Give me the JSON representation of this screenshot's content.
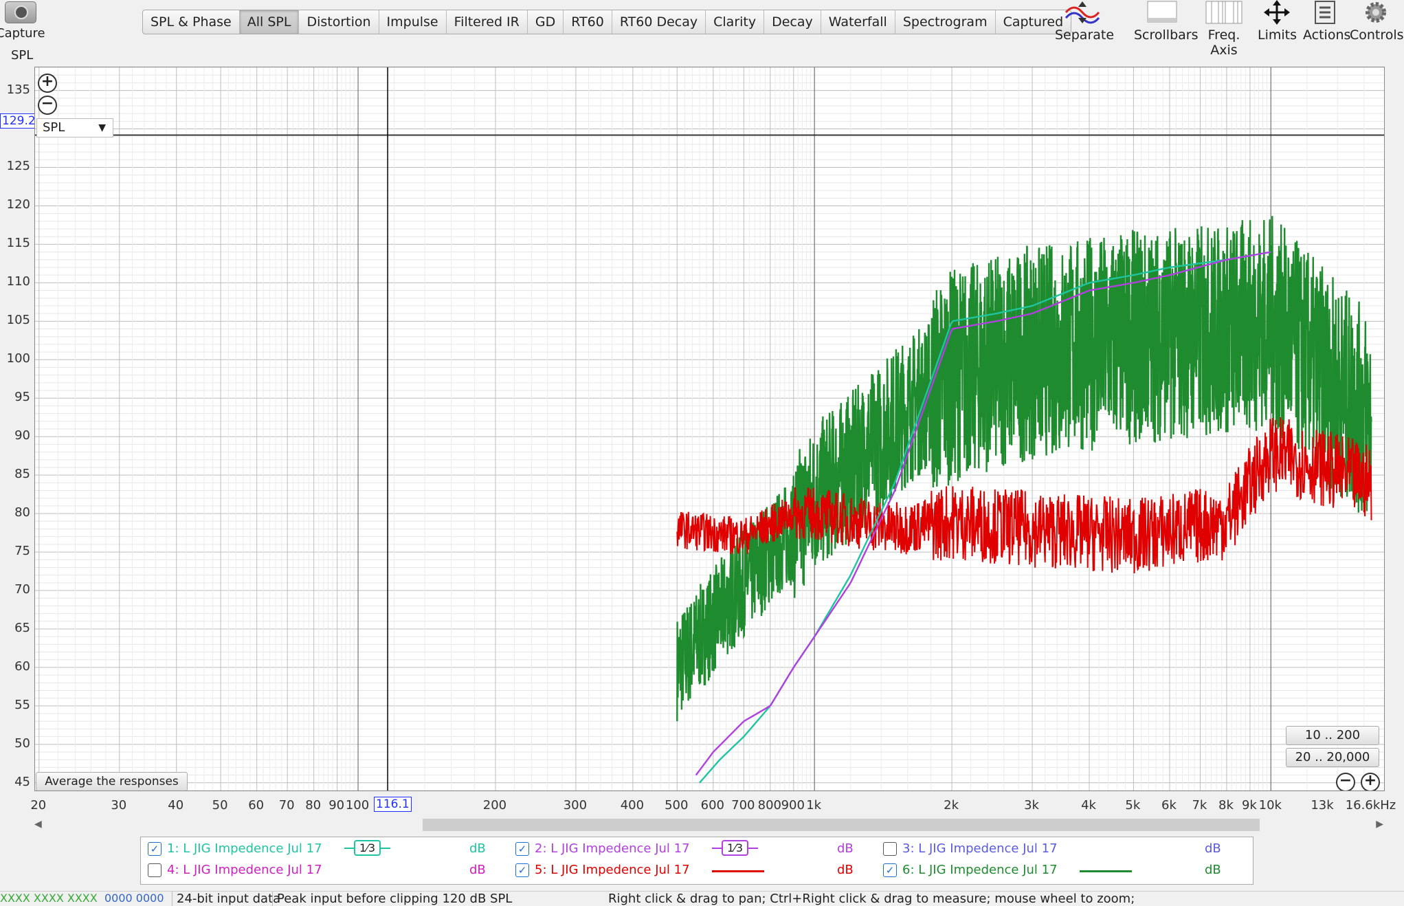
{
  "toolbar": {
    "capture_label": "Capture",
    "tabs": [
      {
        "label": "SPL & Phase"
      },
      {
        "label": "All SPL",
        "active": true
      },
      {
        "label": "Distortion"
      },
      {
        "label": "Impulse"
      },
      {
        "label": "Filtered IR"
      },
      {
        "label": "GD"
      },
      {
        "label": "RT60"
      },
      {
        "label": "RT60 Decay"
      },
      {
        "label": "Clarity"
      },
      {
        "label": "Decay"
      },
      {
        "label": "Waterfall"
      },
      {
        "label": "Spectrogram"
      },
      {
        "label": "Captured"
      }
    ],
    "tools": {
      "separate": "Separate",
      "scrollbars": "Scrollbars",
      "freq_axis": "Freq. Axis",
      "limits": "Limits",
      "actions": "Actions",
      "controls": "Controls"
    }
  },
  "plot": {
    "y_axis_title": "SPL",
    "y_cursor_value": "129.2",
    "x_cursor_value": "116.1",
    "trace_selector": "SPL",
    "average_button": "Average the responses",
    "range_button_1": "10 .. 200",
    "range_button_2": "20 .. 20,000"
  },
  "chart_data": {
    "type": "line",
    "xlabel": "",
    "ylabel": "SPL",
    "x_scale": "log",
    "ylim": [
      44,
      138
    ],
    "xlim": [
      19.6,
      17700
    ],
    "grid": true,
    "y_ticks": [
      "135",
      "125",
      "120",
      "115",
      "110",
      "105",
      "100",
      "95",
      "90",
      "85",
      "80",
      "75",
      "70",
      "65",
      "60",
      "55",
      "50",
      "45"
    ],
    "x_ticks": [
      "20",
      "30",
      "40",
      "50",
      "60",
      "70",
      "80",
      "90",
      "100",
      "200",
      "300",
      "400",
      "500",
      "600",
      "700",
      "800",
      "900",
      "1k",
      "2k",
      "3k",
      "4k",
      "5k",
      "6k",
      "7k",
      "8k",
      "9k",
      "10k",
      "13k",
      "16.6kHz"
    ],
    "x_tick_values": [
      20,
      30,
      40,
      50,
      60,
      70,
      80,
      90,
      100,
      200,
      300,
      400,
      500,
      600,
      700,
      800,
      900,
      1000,
      2000,
      3000,
      4000,
      5000,
      6000,
      7000,
      8000,
      9000,
      10000,
      13000,
      16600
    ],
    "cursor": {
      "x": 116.1,
      "y": 129.2
    },
    "series": [
      {
        "name": "1: L JIG Impedence Jul 17",
        "color": "#1fc4a0",
        "x": [
          560,
          620,
          700,
          800,
          900,
          1000,
          1200,
          1500,
          2000,
          2500,
          3000,
          4000,
          5000,
          6000,
          8000,
          10000
        ],
        "y": [
          45,
          48,
          51,
          55,
          60,
          64,
          72,
          84,
          105,
          106,
          107,
          110,
          111,
          112,
          113,
          114
        ]
      },
      {
        "name": "2: L JIG Impedence Jul 17",
        "color": "#b040e0",
        "x": [
          550,
          600,
          700,
          800,
          900,
          1000,
          1200,
          1500,
          2000,
          2500,
          3000,
          4000,
          5000,
          6000,
          8000,
          10000
        ],
        "y": [
          46,
          49,
          53,
          55,
          60,
          64,
          71,
          83,
          104,
          105,
          106,
          109,
          110,
          111,
          113,
          114
        ]
      },
      {
        "name": "5: L JIG Impedence Jul 17",
        "color": "#e00000",
        "x": [
          500,
          700,
          900,
          1000,
          1500,
          2000,
          3000,
          5000,
          8000,
          10000,
          16600
        ],
        "y": [
          78,
          77,
          80,
          80,
          78,
          79,
          78,
          77,
          79,
          88,
          84
        ]
      },
      {
        "name": "6: L JIG Impedence Jul 17",
        "color": "#1e8c2e",
        "x": [
          500,
          600,
          700,
          800,
          900,
          1000,
          1200,
          1500,
          2000,
          3000,
          5000,
          8000,
          10000,
          16600
        ],
        "y": [
          60,
          66,
          71,
          75,
          78,
          82,
          86,
          92,
          98,
          101,
          103,
          104,
          105,
          92
        ]
      }
    ]
  },
  "legend": {
    "items": [
      {
        "label": "1: L JIG Impedence Jul 17",
        "color": "#1fc4a0",
        "checked": true,
        "smoothing": "1⁄3",
        "unit": "dB"
      },
      {
        "label": "2: L JIG Impedence Jul 17",
        "color": "#b040e0",
        "checked": true,
        "smoothing": "1⁄3",
        "unit": "dB"
      },
      {
        "label": "3: L JIG Impedence Jul 17",
        "color": "#5a5ae0",
        "checked": false,
        "unit": "dB"
      },
      {
        "label": "4: L JIG Impedence Jul 17",
        "color": "#d01fc0",
        "checked": false,
        "unit": "dB"
      },
      {
        "label": "5: L JIG Impedence Jul 17",
        "color": "#e00000",
        "checked": true,
        "unit": "dB"
      },
      {
        "label": "6: L JIG Impedence Jul 17",
        "color": "#1e8c2e",
        "checked": true,
        "unit": "dB"
      }
    ]
  },
  "status": {
    "readout_1": "XXXX XXXX XXXX",
    "readout_2": "0000 0000",
    "input_bits": "24-bit input data",
    "peak": "Peak input before clipping 120 dB SPL",
    "hint": "Right click & drag to pan; Ctrl+Right click & drag to measure; mouse wheel to zoom;"
  }
}
